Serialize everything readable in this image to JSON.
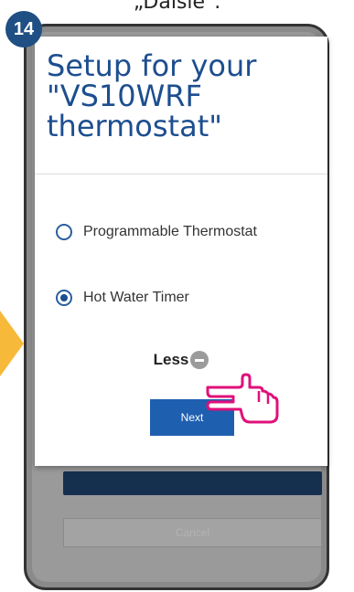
{
  "caption": "„Dalsie\".",
  "step_badge": "14",
  "dialog": {
    "title": "Setup for your \"VS10WRF thermostat\"",
    "options": [
      {
        "label": "Programmable Thermostat",
        "selected": false
      },
      {
        "label": "Hot Water Timer",
        "selected": true
      }
    ],
    "less_label": "Less",
    "next_label": "Next"
  },
  "background": {
    "secondary_button_label": "Cancel"
  },
  "icons": {
    "minus": "minus-circle-icon",
    "hand": "pointing-hand-icon",
    "arrow": "arrow-right-icon"
  },
  "colors": {
    "brand_blue": "#1f5fb0",
    "title_blue": "#1d4e8f",
    "badge": "#1f4f83",
    "arrow": "#f7b93a",
    "hand": "#e0107a"
  }
}
